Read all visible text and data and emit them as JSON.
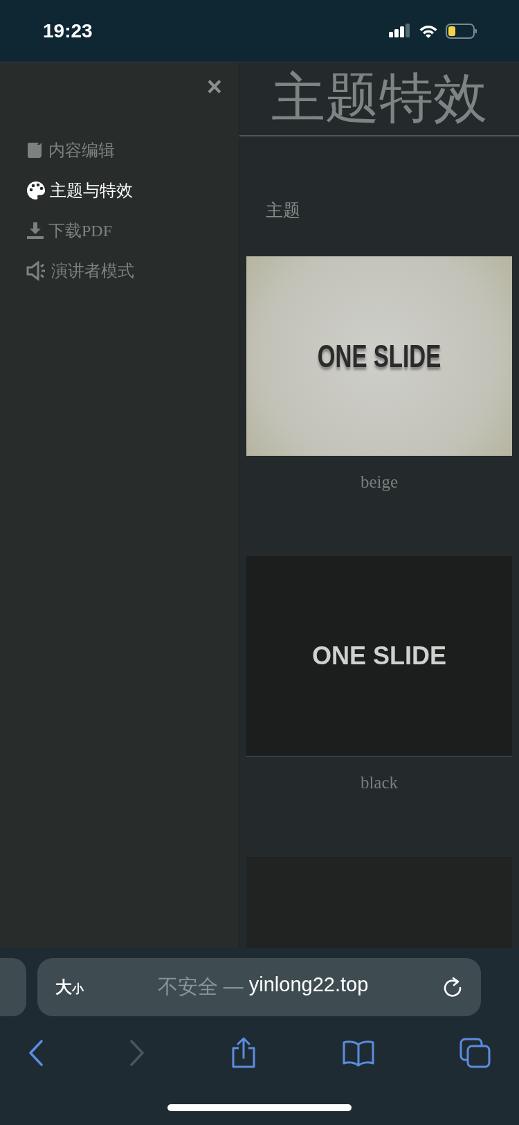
{
  "status_bar": {
    "time": "19:23"
  },
  "sidebar": {
    "close": "×",
    "items": [
      {
        "label": "内容编辑",
        "selected": false
      },
      {
        "label": "主题与特效",
        "selected": true
      },
      {
        "label": "下载PDF",
        "selected": false
      },
      {
        "label": "演讲者模式",
        "selected": false
      }
    ]
  },
  "panel": {
    "title": "主题特效",
    "section": "主题",
    "themes": [
      {
        "name": "beige",
        "kind": "beige",
        "slide_text": "ONE SLIDE"
      },
      {
        "name": "black",
        "kind": "black",
        "slide_text": "ONE SLIDE"
      },
      {
        "kind": "partial"
      }
    ]
  },
  "address_bar": {
    "text_size_large": "大",
    "text_size_small": "小",
    "security_label": "不安全 —",
    "domain": "yinlong22.top"
  },
  "toolbar": {
    "back_disabled": false,
    "forward_disabled": true
  }
}
